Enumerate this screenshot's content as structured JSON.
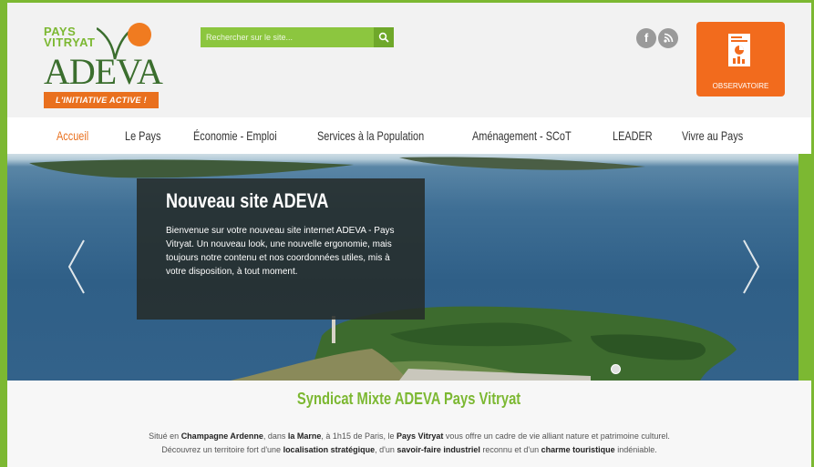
{
  "logo": {
    "line1": "PAYS",
    "line2": "VITRYAT",
    "name": "ADEVA",
    "tagline": "L'INITIATIVE ACTIVE !"
  },
  "search": {
    "placeholder": "Rechercher sur le site...",
    "button_icon": "search-icon"
  },
  "social": [
    {
      "icon": "facebook-icon",
      "glyph": "f"
    },
    {
      "icon": "rss-icon",
      "glyph": "))"
    }
  ],
  "observatoire": {
    "label": "OBSERVATOIRE",
    "icon": "report-document-icon"
  },
  "nav": {
    "items": [
      {
        "label": "Accueil",
        "active": true
      },
      {
        "label": "Le Pays"
      },
      {
        "label": "Économie - Emploi"
      },
      {
        "label": "Services à la Population"
      },
      {
        "label": "Aménagement - SCoT"
      },
      {
        "label": "LEADER"
      },
      {
        "label": "Vivre au Pays"
      }
    ]
  },
  "slider": {
    "title": "Nouveau site ADEVA",
    "text": "Bienvenue sur votre nouveau site internet ADEVA - Pays Vitryat. Un nouveau look, une nouvelle ergonomie, mais toujours notre contenu et nos coordonnées utiles, mis à votre disposition, à tout moment.",
    "prev_icon": "chevron-left-icon",
    "next_icon": "chevron-right-icon"
  },
  "intro": {
    "title": "Syndicat Mixte ADEVA Pays Vitryat",
    "p1": {
      "a": "Situé en ",
      "b": "Champagne Ardenne",
      "c": ", dans ",
      "d": "la Marne",
      "e": ", à 1h15 de Paris, le ",
      "f": "Pays Vitryat",
      "g": " vous offre un cadre de vie alliant nature et patrimoine culturel."
    },
    "p2": {
      "a": "Découvrez un territoire fort d'une ",
      "b": "localisation stratégique",
      "c": ", d'un ",
      "d": "savoir-faire industriel",
      "e": " reconnu et d'un ",
      "f": "charme touristique",
      "g": " indéniable."
    }
  },
  "colors": {
    "brand_green": "#7cb832",
    "brand_orange": "#f26b1d",
    "dark_green": "#3b6e2e"
  }
}
